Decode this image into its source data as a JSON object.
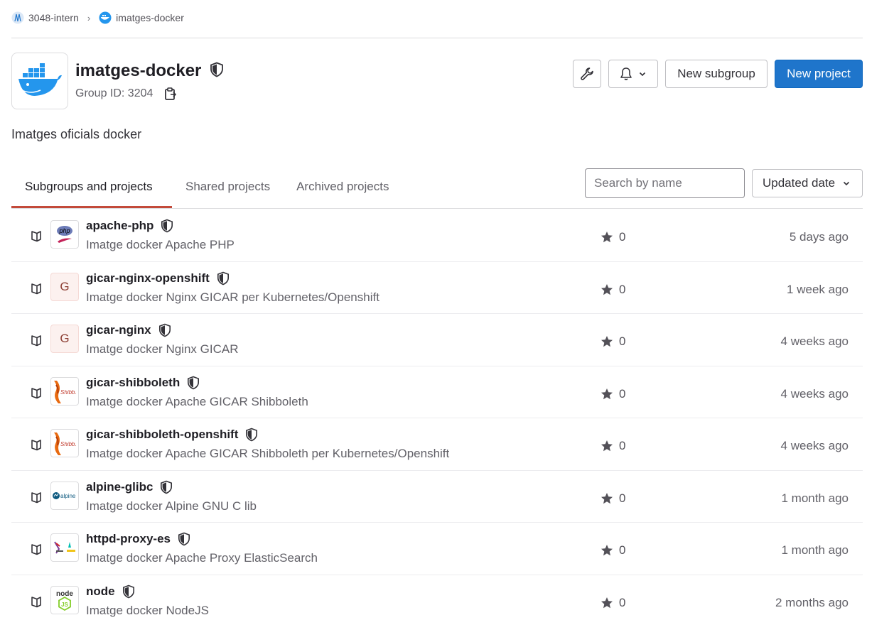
{
  "breadcrumb": [
    {
      "label": "3048-intern",
      "icon": "group-avatar-icon"
    },
    {
      "label": "imatges-docker",
      "icon": "docker-icon"
    }
  ],
  "group": {
    "name": "imatges-docker",
    "id_label": "Group ID: 3204",
    "description": "Imatges oficials docker",
    "visibility_icon": "shield-icon"
  },
  "actions": {
    "settings_icon": "wrench-icon",
    "notifications_icon": "bell-icon",
    "new_subgroup": "New subgroup",
    "new_project": "New project"
  },
  "tabs": [
    {
      "label": "Subgroups and projects",
      "active": true
    },
    {
      "label": "Shared projects",
      "active": false
    },
    {
      "label": "Archived projects",
      "active": false
    }
  ],
  "search": {
    "placeholder": "Search by name"
  },
  "sort": {
    "label": "Updated date"
  },
  "colors": {
    "primary": "#1f75cb",
    "active_tab": "#c34a3a"
  },
  "projects": [
    {
      "name": "apache-php",
      "description": "Imatge docker Apache PHP",
      "stars": "0",
      "updated": "5 days ago",
      "avatar": "php-logo"
    },
    {
      "name": "gicar-nginx-openshift",
      "description": "Imatge docker Nginx GICAR per Kubernetes/Openshift",
      "stars": "0",
      "updated": "1 week ago",
      "avatar": "G"
    },
    {
      "name": "gicar-nginx",
      "description": "Imatge docker Nginx GICAR",
      "stars": "0",
      "updated": "4 weeks ago",
      "avatar": "G"
    },
    {
      "name": "gicar-shibboleth",
      "description": "Imatge docker Apache GICAR Shibboleth",
      "stars": "0",
      "updated": "4 weeks ago",
      "avatar": "shibboleth-logo"
    },
    {
      "name": "gicar-shibboleth-openshift",
      "description": "Imatge docker Apache GICAR Shibboleth per Kubernetes/Openshift",
      "stars": "0",
      "updated": "4 weeks ago",
      "avatar": "shibboleth-logo"
    },
    {
      "name": "alpine-glibc",
      "description": "Imatge docker Alpine GNU C lib",
      "stars": "0",
      "updated": "1 month ago",
      "avatar": "alpine-logo"
    },
    {
      "name": "httpd-proxy-es",
      "description": "Imatge docker Apache Proxy ElasticSearch",
      "stars": "0",
      "updated": "1 month ago",
      "avatar": "apache-es-logo"
    },
    {
      "name": "node",
      "description": "Imatge docker NodeJS",
      "stars": "0",
      "updated": "2 months ago",
      "avatar": "nodejs-logo"
    }
  ]
}
